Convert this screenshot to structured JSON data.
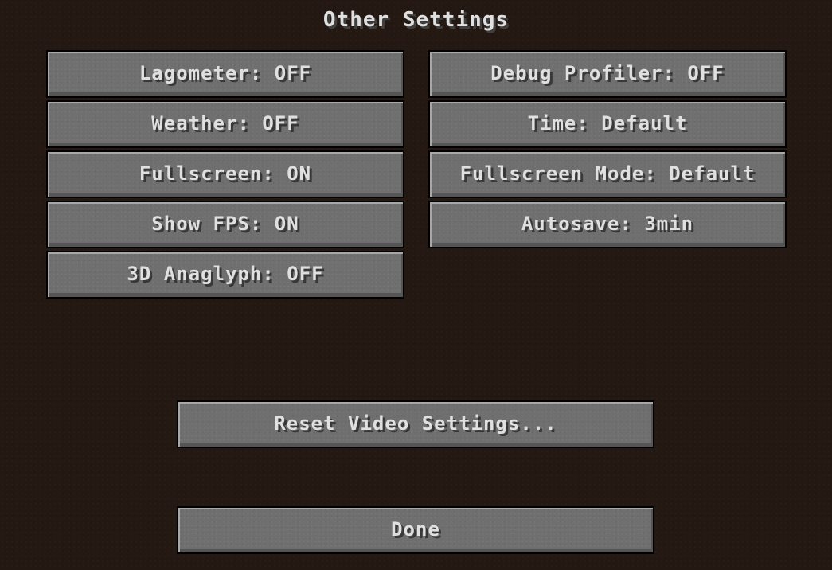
{
  "screen": {
    "title": "Other Settings"
  },
  "settings": {
    "left": [
      {
        "label": "Lagometer: OFF"
      },
      {
        "label": "Weather: OFF"
      },
      {
        "label": "Fullscreen: ON"
      },
      {
        "label": "Show FPS: ON"
      },
      {
        "label": "3D Anaglyph: OFF"
      }
    ],
    "right": [
      {
        "label": "Debug Profiler: OFF"
      },
      {
        "label": "Time: Default"
      },
      {
        "label": "Fullscreen Mode: Default"
      },
      {
        "label": "Autosave: 3min"
      }
    ]
  },
  "actions": {
    "reset_label": "Reset Video Settings...",
    "done_label": "Done"
  }
}
